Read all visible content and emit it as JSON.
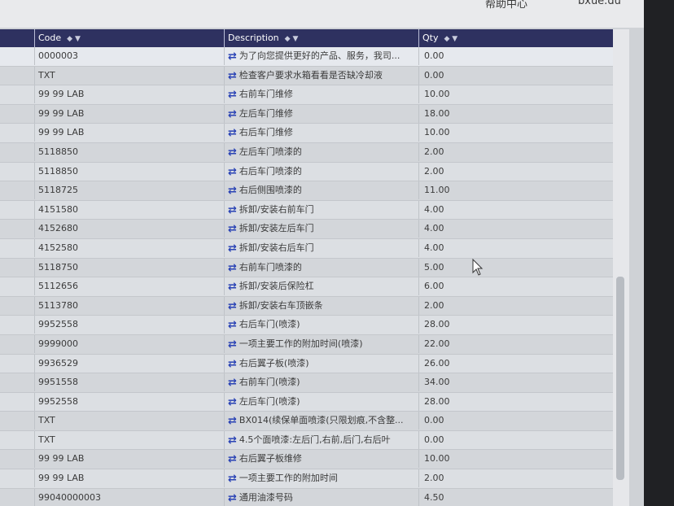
{
  "topbar": {
    "help_label": "帮助中心",
    "user_label": "bxue.du"
  },
  "columns": {
    "code": "Code",
    "description": "Description",
    "qty": "Qty",
    "sort_glyph": "◆ ▼"
  },
  "rows": [
    {
      "code": "0000003",
      "desc": "为了向您提供更好的产品、服务，我司...",
      "qty": "0.00"
    },
    {
      "code": "TXT",
      "desc": "检查客户要求水箱看看是否缺冷却液",
      "qty": "0.00"
    },
    {
      "code": "99 99 LAB",
      "desc": "右前车门维修",
      "qty": "10.00"
    },
    {
      "code": "99 99 LAB",
      "desc": "左后车门维修",
      "qty": "18.00"
    },
    {
      "code": "99 99 LAB",
      "desc": "右后车门维修",
      "qty": "10.00"
    },
    {
      "code": "5118850",
      "desc": "左后车门喷漆的",
      "qty": "2.00"
    },
    {
      "code": "5118850",
      "desc": "右后车门喷漆的",
      "qty": "2.00"
    },
    {
      "code": "5118725",
      "desc": "右后侧围喷漆的",
      "qty": "11.00"
    },
    {
      "code": "4151580",
      "desc": "拆卸/安装右前车门",
      "qty": "4.00"
    },
    {
      "code": "4152680",
      "desc": "拆卸/安装左后车门",
      "qty": "4.00"
    },
    {
      "code": "4152580",
      "desc": "拆卸/安装右后车门",
      "qty": "4.00"
    },
    {
      "code": "5118750",
      "desc": "右前车门喷漆的",
      "qty": "5.00"
    },
    {
      "code": "5112656",
      "desc": "拆卸/安装后保险杠",
      "qty": "6.00"
    },
    {
      "code": "5113780",
      "desc": "拆卸/安装右车顶嵌条",
      "qty": "2.00"
    },
    {
      "code": "9952558",
      "desc": "右后车门(喷漆)",
      "qty": "28.00"
    },
    {
      "code": "9999000",
      "desc": "一项主要工作的附加时间(喷漆)",
      "qty": "22.00"
    },
    {
      "code": "9936529",
      "desc": "右后翼子板(喷漆)",
      "qty": "26.00"
    },
    {
      "code": "9951558",
      "desc": "右前车门(喷漆)",
      "qty": "34.00"
    },
    {
      "code": "9952558",
      "desc": "左后车门(喷漆)",
      "qty": "28.00"
    },
    {
      "code": "TXT",
      "desc": "BX014(续保单面喷漆(只限划痕,不含整...",
      "qty": "0.00"
    },
    {
      "code": "TXT",
      "desc": "4.5个面喷漆:左后门,右前,后门,右后叶",
      "qty": "0.00"
    },
    {
      "code": "99 99 LAB",
      "desc": "右后翼子板维修",
      "qty": "10.00"
    },
    {
      "code": "99 99 LAB",
      "desc": "一项主要工作的附加时间",
      "qty": "2.00"
    },
    {
      "code": "99040000003",
      "desc": "通用油漆号码",
      "qty": "4.50"
    }
  ],
  "icons": {
    "transfer": "⇄"
  }
}
